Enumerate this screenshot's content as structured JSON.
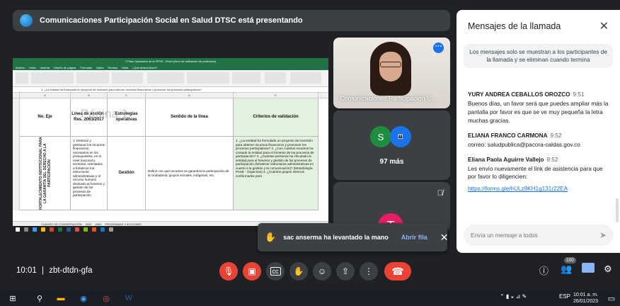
{
  "presentation": {
    "title": "Comunicaciones Participación Social en Salud DTSC está presentando"
  },
  "excel": {
    "window_title": "1 Paso Operación de la PPSS - Excel (Error de activación de productos)",
    "menu": [
      "Archivo",
      "Inicio",
      "Insertar",
      "Diseño de página",
      "Fórmulas",
      "Datos",
      "Revisar",
      "Vista",
      "¿Qué desea hacer?"
    ],
    "formula": "1. ¿La entidad ha formulado un proyecto de inversión para obtener recursos financieros o promover los procesos participativos?",
    "columns": [
      "A",
      "B",
      "C",
      "D",
      "E"
    ],
    "watermark_1": "Página 1",
    "watermark_2": "Página 8",
    "headers": {
      "no_eje": "No. Eje",
      "linea_accion": "Línea de acción - Res. 2063/2017",
      "estrategias": "Estrategias operativas",
      "sentido": "Sentido de la línea",
      "criterios": "Criterios de validación"
    },
    "eje_vertical": "FORTALECIMIENTO INSTITUCIONAL PARA LA GARANTÍA DEL DERECHO A LA PARTICIPACIÓN",
    "linea_text": "1. Destinar y gestionar los recursos financieros necesarios en los presupuestos, en el nivel nacional y territorial, orientados a fortalecer los estructuras administrativas y el recurso humano dedicado al fomento y gestión de los procesos de participación",
    "estrategia_value": "Gestión",
    "sentido_text": "Definir con qué recursos se garantiza la participación de la ciudadanía, grupos sociales, indígenas, etc.",
    "criterios_text": "1. ¿La entidad ha formulado un proyecto de inversión para obtener recursos financieros y promover los procesos participativos? 2. ¿Con cuántos recursos ha contado la entidad para el fomento de los procesos de participación? 3. ¿Cuántas personas ha vinculado la entidad para el fomento y gestión de los procesos de participación (fortalecer estructuras administrativas en cuanto a la gestión y la comunicación)? (Metodología PASE - Organizar) 4. ¿Cuántos grupos internos conformados para",
    "tabs": [
      "CUADRO DE CONVERSACIÓN",
      "2020",
      "2021",
      "PROGRAMAS Y ACCIONES"
    ]
  },
  "participants": {
    "presenter_label": "Comunicaciones Participación S...",
    "avatar_s": "S",
    "avatar_t": "T",
    "more_count_label": "97 más"
  },
  "toast": {
    "text": "sac anserma ha levantado la mano",
    "action": "Abrir fila"
  },
  "chat": {
    "title": "Mensajes de la llamada",
    "notice": "Los mensajes solo se muestran a los participantes de la llamada y se eliminan cuando termina",
    "messages": [
      {
        "name": "YURY ANDREA CEBALLOS OROZCO",
        "time": "9:51",
        "body": "Buenos días, un favor será que puedes ampliar más la pantalla por favor es que se ve muy pequeña la letra muchas gracias."
      },
      {
        "name": "ELIANA FRANCO CARMONA",
        "time": "9:52",
        "body": "correo: saludpublica@pacora-caldas.gov.co"
      },
      {
        "name": "Eliana Paola Aguirre Vallejo",
        "time": "9:52",
        "body": "Les envío nuevamente el link de asistencia para que por favor lo diligencien:",
        "link": "https://forms.gle/hULz9KH1g131r22EA"
      }
    ],
    "input_placeholder": "Envía un mensaje a todos"
  },
  "meeting": {
    "time": "10:01",
    "separator": "|",
    "code": "zbt-dtdn-gfa",
    "participant_count": "100"
  },
  "taskbar": {
    "lang": "ESP",
    "time": "10:01 a. m.",
    "date": "26/01/2023"
  },
  "colors": {
    "accent": "#1a73e8",
    "danger": "#ea4335",
    "excel_green": "#217346"
  }
}
